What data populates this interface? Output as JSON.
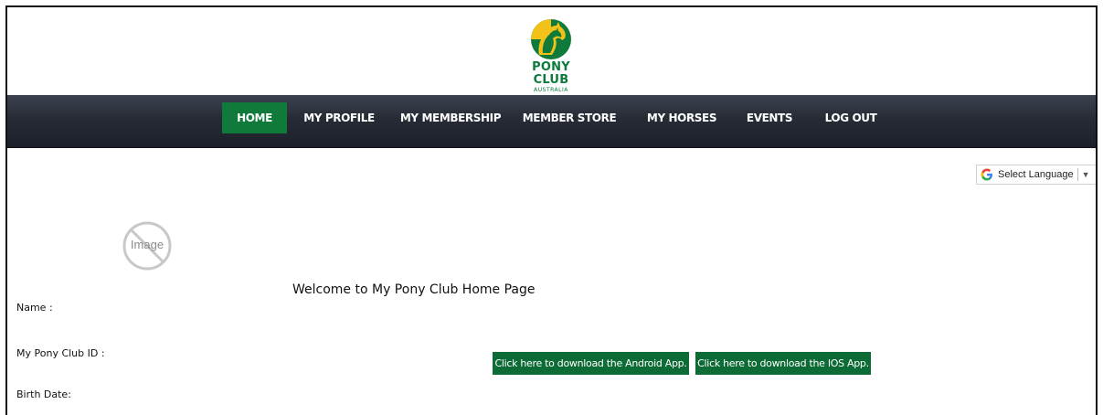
{
  "brand": {
    "title": "PONY CLUB",
    "subtitle": "AUSTRALIA",
    "colors": {
      "green": "#0f7a39",
      "yellow": "#f3c218"
    }
  },
  "nav": {
    "items": [
      {
        "label": "HOME",
        "active": true
      },
      {
        "label": "MY PROFILE"
      },
      {
        "label": "MY MEMBERSHIP"
      },
      {
        "label": "MEMBER STORE"
      },
      {
        "label": "MY HORSES"
      },
      {
        "label": "EVENTS"
      },
      {
        "label": "LOG OUT"
      }
    ],
    "active_color": "#0f7a39"
  },
  "language": {
    "label": "Select Language",
    "icon": "google-g-icon",
    "arrow": "▼"
  },
  "profile": {
    "image_placeholder": "Image",
    "welcome": "Welcome to My Pony Club Home Page",
    "fields": [
      {
        "label": "Name :"
      },
      {
        "label": "My Pony Club ID :"
      },
      {
        "label": "Birth Date:"
      }
    ]
  },
  "downloads": {
    "android_label": "Click here to download the Android App.",
    "ios_label": "Click here to download the IOS App.",
    "button_color": "#0d6b35"
  }
}
